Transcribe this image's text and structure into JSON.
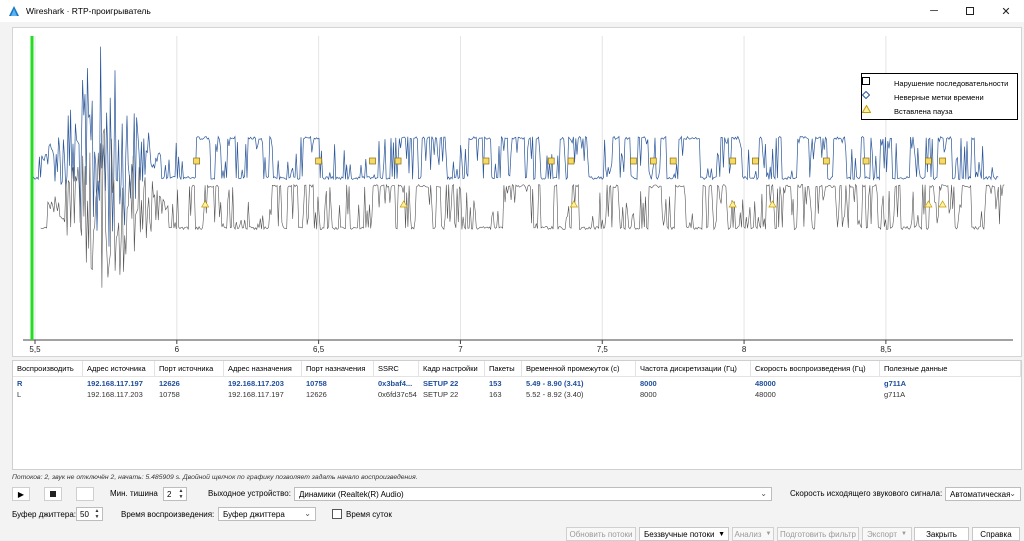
{
  "window": {
    "title": "Wireshark · RTP-проигрыватель",
    "controls": [
      "minimize-icon",
      "maximize-icon",
      "close-icon"
    ]
  },
  "chart_data": {
    "type": "line",
    "x_ticks": [
      "5,5",
      "6",
      "6,5",
      "7",
      "7,5",
      "8",
      "8,5"
    ],
    "x_tick_values": [
      5.5,
      6,
      6.5,
      7,
      7.5,
      8,
      8.5
    ],
    "xlim": [
      5.485909,
      8.92
    ],
    "grid": true,
    "legend_placement": "top-right",
    "playhead_x": 5.485909,
    "series": [
      {
        "name": "R",
        "color": "#2b579a",
        "x_range": [
          5.49,
          8.9
        ],
        "center": "upper"
      },
      {
        "name": "L",
        "color": "#555555",
        "x_range": [
          5.52,
          8.92
        ],
        "center": "lower"
      }
    ],
    "legend": [
      {
        "symbol": "square",
        "label": "Нарушение последовательности"
      },
      {
        "symbol": "diamond",
        "label": "Неверные метки времени"
      },
      {
        "symbol": "triangle",
        "label": "Вставлена пауза"
      }
    ],
    "markers": {
      "R_square": [
        6.07,
        6.5,
        6.69,
        6.78,
        7.09,
        7.32,
        7.39,
        7.61,
        7.68,
        7.75,
        7.96,
        8.04,
        8.29,
        8.43,
        8.65,
        8.7
      ],
      "R_triangle": [
        6.1,
        6.51,
        6.8,
        7.09,
        7.33,
        7.4,
        7.61,
        7.69,
        8.3,
        8.66
      ],
      "L_triangle": [
        6.1,
        6.8,
        7.4,
        7.96,
        8.1,
        8.65,
        8.7
      ]
    }
  },
  "table": {
    "columns": [
      "Воспроизводить",
      "Адрес источника",
      "Порт источника",
      "Адрес назначения",
      "Порт назначения",
      "SSRC",
      "Кадр настройки",
      "Пакеты",
      "Временной промежуток (с)",
      "Частота дискретизации (Гц)",
      "Скорость воспроизведения (Гц)",
      "Полезные данные"
    ],
    "rows": [
      [
        "R",
        "192.168.117.197",
        "12626",
        "192.168.117.203",
        "10758",
        "0x3baf4...",
        "SETUP 22",
        "153",
        "5.49 - 8.90 (3.41)",
        "8000",
        "48000",
        "g711A"
      ],
      [
        "L",
        "192.168.117.203",
        "10758",
        "192.168.117.197",
        "12626",
        "0x6fd37c54",
        "SETUP 22",
        "163",
        "5.52 - 8.92 (3.40)",
        "8000",
        "48000",
        "g711A"
      ]
    ]
  },
  "status_text": "Потоков: 2, звук не отключён 2, начать: 5.485909 s. Двойной щелчок по графику позволяет задать начало воспроизведения.",
  "controls": {
    "min_silence_label": "Мин. тишина",
    "min_silence_value": "2",
    "output_device_label": "Выходное устройство:",
    "output_device_value": "Динамики (Realtek(R) Audio)",
    "output_rate_label": "Скорость исходящего звукового сигнала:",
    "output_rate_value": "Автоматическая",
    "jitter_buffer_label": "Буфер джиттера:",
    "jitter_buffer_value": "50",
    "playback_time_label": "Время воспроизведения:",
    "playback_time_value": "Буфер джиттера",
    "time_of_day_label": "Время суток"
  },
  "buttons": {
    "refresh": "Обновить потоки",
    "mute": "Беззвучные потоки",
    "analyze": "Анализ",
    "prepare_filter": "Подготовить фильтр",
    "export": "Экспорт",
    "close": "Закрыть",
    "help": "Справка"
  }
}
